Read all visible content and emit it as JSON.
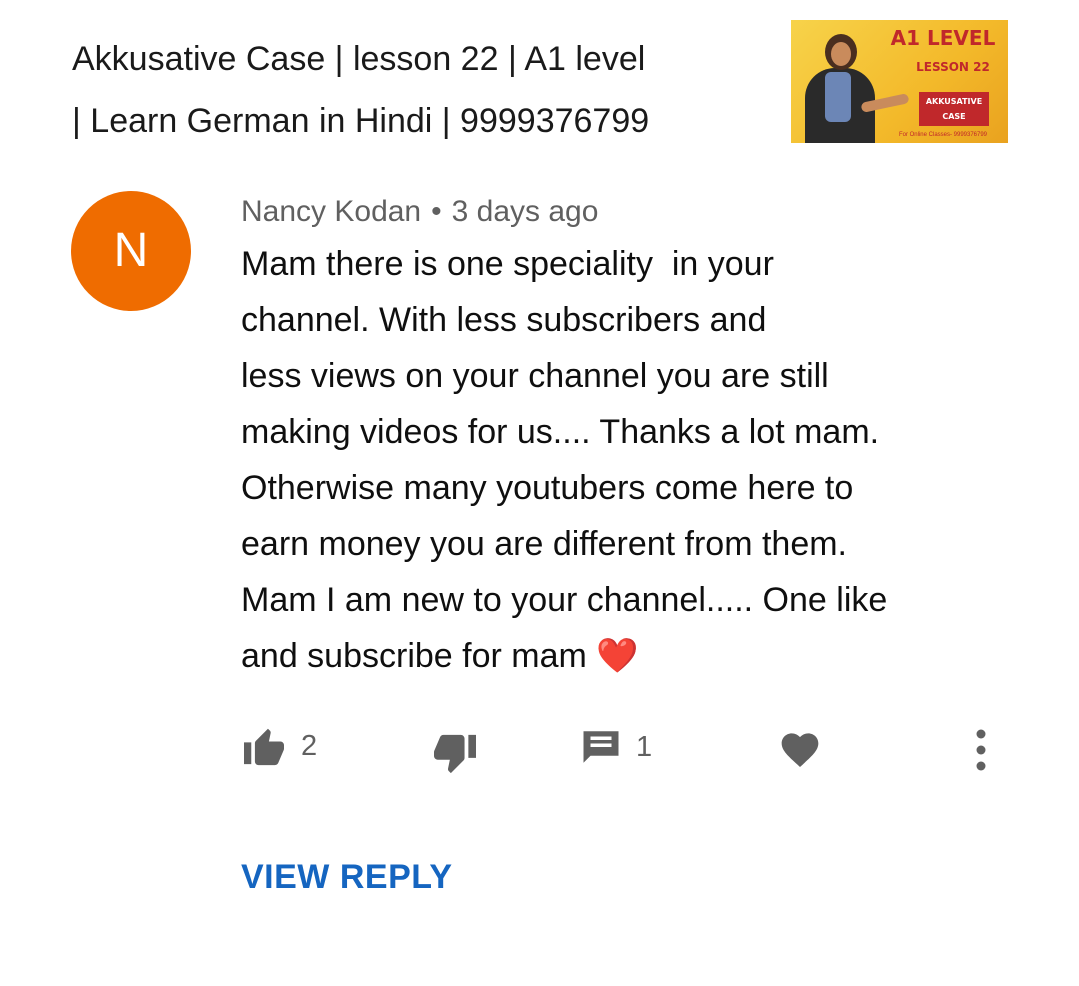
{
  "video": {
    "title_line1": "Akkusative Case  | lesson 22 | A1 level",
    "title_line2": "| Learn German in Hindi | 9999376799",
    "thumbnail": {
      "level_text": "A1 LEVEL",
      "lesson_text": "LESSON 22",
      "topic_line1": "AKKUSATIVE",
      "topic_line2": "CASE",
      "footer_text": "For Online Classes- 9999376799"
    }
  },
  "comment": {
    "avatar_letter": "N",
    "avatar_color": "#ef6c00",
    "author": "Nancy Kodan",
    "separator": "•",
    "time": "3 days ago",
    "lines": [
      "Mam there is one speciality  in your",
      "channel. With less subscribers and",
      "less views on your channel you are still",
      "making videos for us.... Thanks a lot mam.",
      "Otherwise many youtubers come here to",
      "earn money you are different from them.",
      "Mam I am new to your channel..... One like",
      "and subscribe for mam ❤️"
    ],
    "likes": "2",
    "replies": "1",
    "view_reply_label": "VIEW REPLY"
  },
  "icons": {
    "like": "thumbs-up-icon",
    "dislike": "thumbs-down-icon",
    "reply": "comment-icon",
    "heart": "heart-icon",
    "more": "more-vertical-icon"
  },
  "colors": {
    "accent": "#1565c0",
    "icon_gray": "#606060"
  }
}
